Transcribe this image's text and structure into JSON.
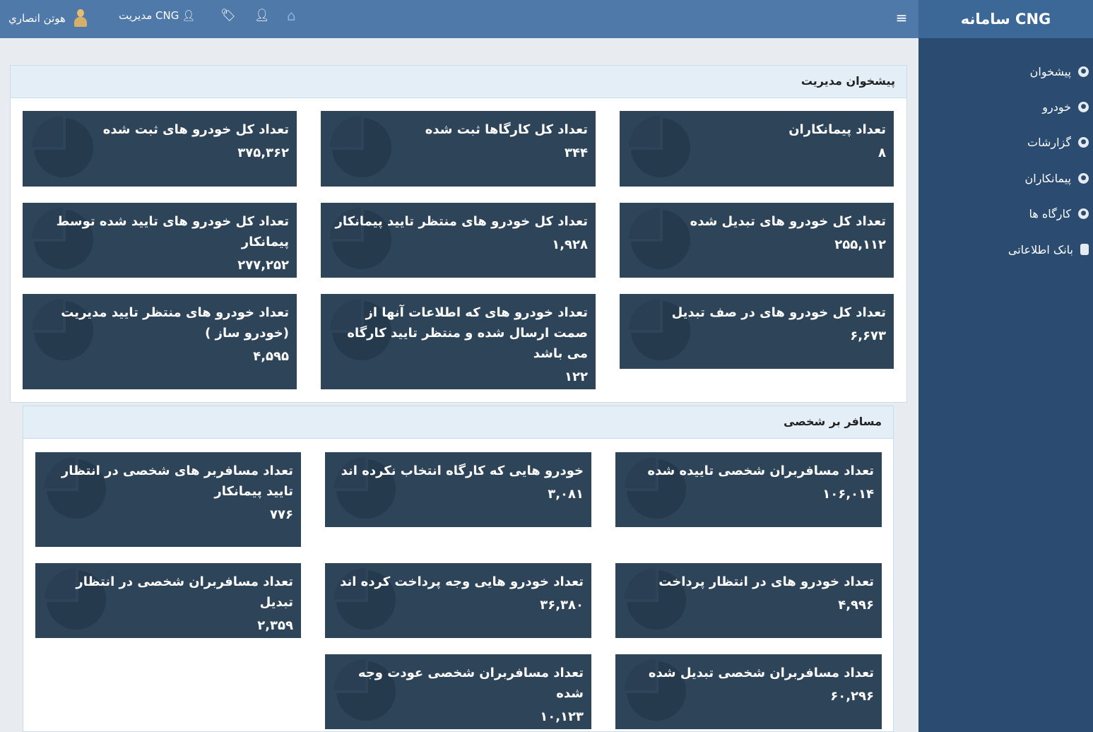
{
  "app": {
    "brand": "سامانه CNG"
  },
  "topbar": {
    "admin_label": "مديريت CNG",
    "user_name": "هوتن انصاري",
    "menu_glyph": "≡"
  },
  "sidebar": {
    "items": [
      {
        "label": "پیشخوان",
        "icon": "globe-icon"
      },
      {
        "label": "خودرو",
        "icon": "globe-icon"
      },
      {
        "label": "گزارشات",
        "icon": "globe-icon"
      },
      {
        "label": "پیمانکاران",
        "icon": "globe-icon"
      },
      {
        "label": "کارگاه ها",
        "icon": "globe-icon"
      },
      {
        "label": "بانک اطلاعاتی",
        "icon": "database-icon"
      }
    ]
  },
  "dashboard": {
    "title": "پیشخوان مدیریت",
    "cards": [
      {
        "title": "تعداد پیمانکاران",
        "value": "۸"
      },
      {
        "title": "تعداد کل کارگاها ثبت شده",
        "value": "۳۴۴"
      },
      {
        "title": "تعداد کل خودرو های ثبت شده",
        "value": "۳۷۵,۳۶۲"
      },
      {
        "title": "تعداد کل خودرو های تبدیل شده",
        "value": "۲۵۵,۱۱۲"
      },
      {
        "title": "تعداد کل خودرو های منتظر تایید پیمانکار",
        "value": "۱,۹۲۸"
      },
      {
        "title": "تعداد کل خودرو های تایید شده توسط پیمانکار",
        "value": "۲۷۷,۲۵۲"
      },
      {
        "title": "تعداد کل خودرو های در صف تبدیل",
        "value": "۶,۶۷۳"
      },
      {
        "title": "تعداد خودرو های که اطلاعات آنها از صمت ارسال شده و منتظر تایید کارگاه می باشد",
        "value": "۱۲۲"
      },
      {
        "title": "تعداد خودرو های منتظر تایید مدیریت (خودرو ساز )",
        "value": "۴,۵۹۵"
      }
    ]
  },
  "personal": {
    "title": "مسافر بر شخصی",
    "cards": [
      {
        "title": "تعداد مسافربران شخصی تاییده شده",
        "value": "۱۰۶,۰۱۴"
      },
      {
        "title": "خودرو هایی که کارگاه انتخاب نکرده اند",
        "value": "۳,۰۸۱"
      },
      {
        "title": "تعداد مسافربر های شخصی در انتظار تایید پیمانکار",
        "value": "۷۷۶"
      },
      {
        "title": "تعداد خودرو های در انتظار پرداخت",
        "value": "۴,۹۹۶"
      },
      {
        "title": "تعداد خودرو هایی وجه پرداخت کرده اند",
        "value": "۳۶,۳۸۰"
      },
      {
        "title": "تعداد مسافربران شخصی در انتظار تبدیل",
        "value": "۲,۳۵۹"
      },
      {
        "title": "تعداد مسافربران شخصی تبدیل شده",
        "value": "۶۰,۲۹۶"
      },
      {
        "title": "تعداد مسافربران شخصی عودت وجه شده",
        "value": "۱۰,۱۲۳"
      }
    ]
  }
}
